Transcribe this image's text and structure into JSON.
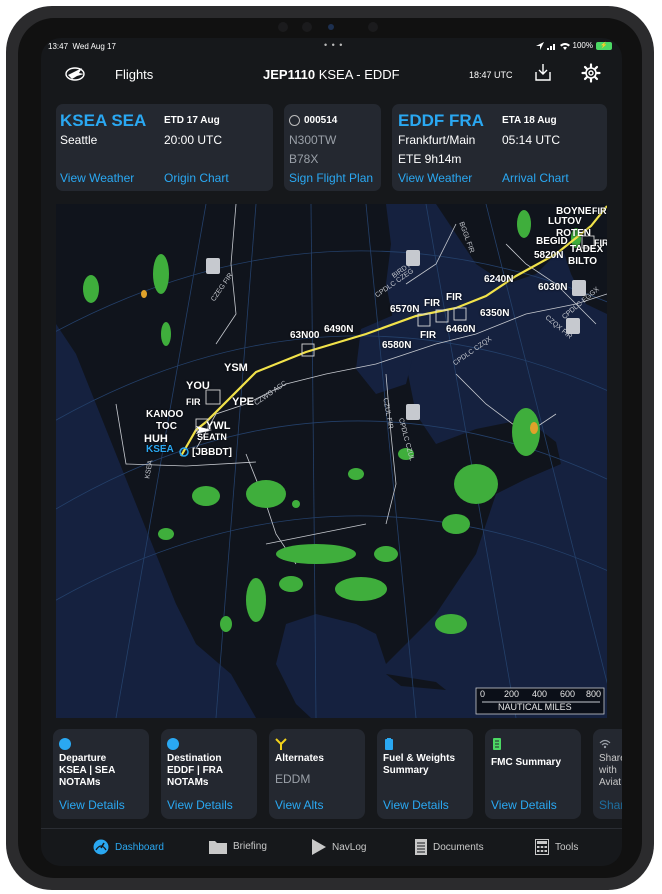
{
  "status_bar": {
    "time": "13:47",
    "date": "Wed Aug 17",
    "center": "• • •",
    "battery": "100%"
  },
  "nav": {
    "flights_label": "Flights",
    "flight_id": "JEP1110",
    "route": "KSEA - EDDF",
    "utc_time": "18:47 UTC"
  },
  "origin": {
    "code": "KSEA SEA",
    "city": "Seattle",
    "etd_label": "ETD 17 Aug",
    "etd_time": "20:00 UTC",
    "weather_link": "View Weather",
    "chart_link": "Origin Chart"
  },
  "aircraft": {
    "flight_plan_no": "000514",
    "registration": "N300TW",
    "type": "B78X",
    "sign_link": "Sign Flight Plan"
  },
  "destination": {
    "code": "EDDF FRA",
    "city": "Frankfurt/Main",
    "ete": "ETE 9h14m",
    "eta_label": "ETA 18 Aug",
    "eta_time": "05:14 UTC",
    "weather_link": "View Weather",
    "chart_link": "Arrival Chart"
  },
  "map": {
    "waypoints": [
      "KSEA",
      "HUH",
      "TOC",
      "KANOO",
      "FIR",
      "YOU",
      "YWL",
      "SEATN",
      "[JBBDT]",
      "YPE",
      "YSM",
      "63N00",
      "6490N",
      "6570N",
      "6580N",
      "6460N",
      "FIR",
      "FIR",
      "FIR",
      "6350N",
      "6240N",
      "6030N",
      "5820N",
      "BILTO",
      "TADEX",
      "BEGID",
      "ROTEN",
      "LUTOV",
      "BOYNE",
      "FIR",
      "FIR"
    ],
    "airspace_labels": [
      "CZEG FIR",
      "BIRD ACC",
      "CPDLC CZEG",
      "BGGL FIR",
      "CZWG ACC",
      "CZUL FIR",
      "CPDLC CZUL",
      "CPDLC CZQX",
      "CPDLC EGGX",
      "CZQX FIR",
      "KSEA"
    ],
    "scale_ticks": [
      "0",
      "200",
      "400",
      "600",
      "800"
    ],
    "scale_label": "NAUTICAL MILES"
  },
  "bottom_cards": [
    {
      "name": "departure-notams",
      "title_lines": [
        "Departure",
        "KSEA | SEA",
        "NOTAMs"
      ],
      "subtitle": "",
      "link": "View Details",
      "icon_color": "#2aa8f2"
    },
    {
      "name": "destination-notams",
      "title_lines": [
        "Destination",
        "EDDF | FRA",
        "NOTAMs"
      ],
      "subtitle": "",
      "link": "View Details",
      "icon_color": "#2aa8f2"
    },
    {
      "name": "alternates",
      "title_lines": [
        "Alternates"
      ],
      "subtitle": "EDDM",
      "link": "View Alts",
      "icon_color": "#f2d21b"
    },
    {
      "name": "fuel-weights",
      "title_lines": [
        "Fuel & Weights",
        "Summary"
      ],
      "subtitle": "",
      "link": "View Details",
      "icon_color": "#2aa8f2"
    },
    {
      "name": "fmc-summary",
      "title_lines": [
        "FMC Summary"
      ],
      "subtitle": "",
      "link": "View Details",
      "icon_color": "#4cd964"
    },
    {
      "name": "share-aviator",
      "title_lines": [
        "Share",
        "with",
        "Aviat"
      ],
      "subtitle": "",
      "link": "Shar",
      "icon_color": "#9aa0a8"
    }
  ],
  "tabs": [
    {
      "label": "Dashboard",
      "icon": "gauge-icon",
      "active": true
    },
    {
      "label": "Briefing",
      "icon": "folder-icon",
      "active": false
    },
    {
      "label": "NavLog",
      "icon": "navlog-icon",
      "active": false
    },
    {
      "label": "Documents",
      "icon": "document-icon",
      "active": false
    },
    {
      "label": "Tools",
      "icon": "tools-icon",
      "active": false
    }
  ],
  "colors": {
    "accent": "#2aa8f2",
    "route": "#f1e24a",
    "map_bg": "#15213f",
    "land": "#10141c",
    "weather": "#3fae3c"
  }
}
